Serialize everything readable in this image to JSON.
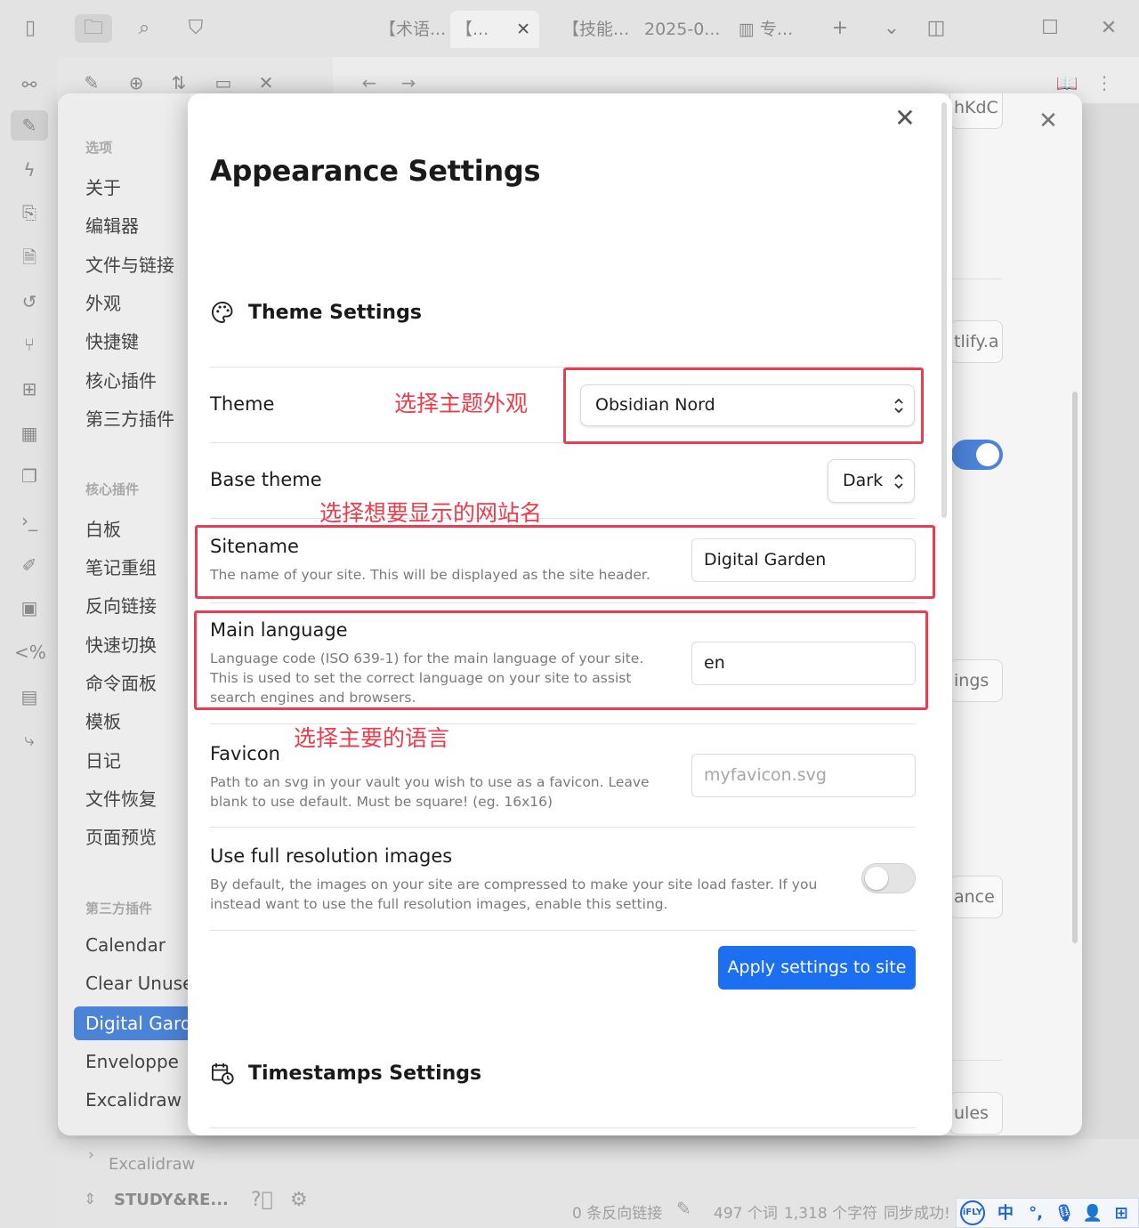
{
  "titlebar": {
    "tabs": [
      "【术语...",
      "【...",
      "【技能...",
      "2025-0...",
      "专..."
    ]
  },
  "file_explorer": {
    "tree_item": "Excalidraw",
    "vault_name": "STUDY&RE..."
  },
  "statusbar": {
    "backlinks": "0 条反向链接",
    "words": "497 个词",
    "chars": "1,318 个字符",
    "sync": "同步成功!"
  },
  "ime": {
    "lang": "中",
    "brand": "iFLY"
  },
  "settings": {
    "sections": [
      {
        "header": "选项",
        "items": [
          "关于",
          "编辑器",
          "文件与链接",
          "外观",
          "快捷键",
          "核心插件",
          "第三方插件"
        ]
      },
      {
        "header": "核心插件",
        "items": [
          "白板",
          "笔记重组",
          "反向链接",
          "快速切换",
          "命令面板",
          "模板",
          "日记",
          "文件恢复",
          "页面预览"
        ]
      },
      {
        "header": "第三方插件",
        "items": [
          "Calendar",
          "Clear Unused",
          "Digital Garden",
          "Enveloppe",
          "Excalidraw"
        ]
      }
    ],
    "active_item": "Digital Garden",
    "peek": {
      "netlify_token": "hKdC",
      "netlify_url": "tlify.a",
      "settings_btn": "ings",
      "appearance_btn": "ance",
      "rules_btn": "ules"
    }
  },
  "modal": {
    "title": "Appearance Settings",
    "theme_section": "Theme Settings",
    "timestamps_section": "Timestamps Settings",
    "theme": {
      "label": "Theme",
      "value": "Obsidian Nord"
    },
    "base_theme": {
      "label": "Base theme",
      "value": "Dark"
    },
    "sitename": {
      "label": "Sitename",
      "desc": "The name of your site. This will be displayed as the site header.",
      "value": "Digital Garden"
    },
    "main_language": {
      "label": "Main language",
      "desc": "Language code (ISO 639-1) for the main language of your site. This is used to set the correct language on your site to assist search engines and browsers.",
      "value": "en"
    },
    "favicon": {
      "label": "Favicon",
      "desc": "Path to an svg in your vault you wish to use as a favicon. Leave blank to use default. Must be square! (eg. 16x16)",
      "placeholder": "myfavicon.svg"
    },
    "full_res": {
      "label": "Use full resolution images",
      "desc": "By default, the images on your site are compressed to make your site load faster. If you instead want to use the full resolution images, enable this setting.",
      "enabled": false
    },
    "apply_label": "Apply settings to site"
  },
  "annotations": {
    "theme": "选择主题外观",
    "sitename": "选择想要显示的网站名",
    "language": "选择主要的语言"
  },
  "colors": {
    "accent": "#1b6ff0",
    "annotation": "#ea3c55",
    "sidebar_active": "#4b83d9"
  }
}
